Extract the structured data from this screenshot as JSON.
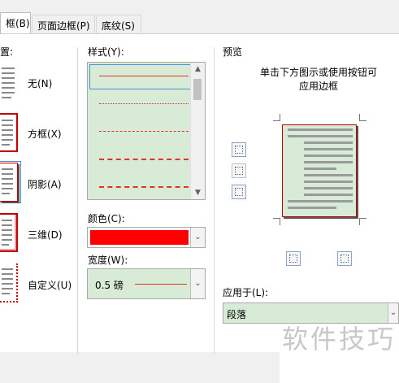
{
  "tabs": [
    {
      "label": "框(B)"
    },
    {
      "label": "页面边框(P)"
    },
    {
      "label": "底纹(S)"
    }
  ],
  "setting": {
    "partial_label": "置:",
    "items": [
      {
        "label": "无(N)"
      },
      {
        "label": "方框(X)"
      },
      {
        "label": "阴影(A)"
      },
      {
        "label": "三维(D)"
      },
      {
        "label": "自定义(U)"
      }
    ]
  },
  "style": {
    "label": "样式(Y):",
    "line_color": "#e0342a"
  },
  "color": {
    "label": "颜色(C):",
    "value": "#ff0000"
  },
  "width": {
    "label": "宽度(W):",
    "value": "0.5 磅"
  },
  "preview": {
    "label": "预览",
    "instruction": "单击下方图示或使用按钮可\n应用边框",
    "page_fill": "#d7ebd6",
    "border_color": "#c00000"
  },
  "apply_to": {
    "label": "应用于(L):",
    "value": "段落"
  },
  "watermark": "软件技巧",
  "colors": {
    "accent_blue": "#4a90d9",
    "list_bg": "#d7ebd6"
  }
}
